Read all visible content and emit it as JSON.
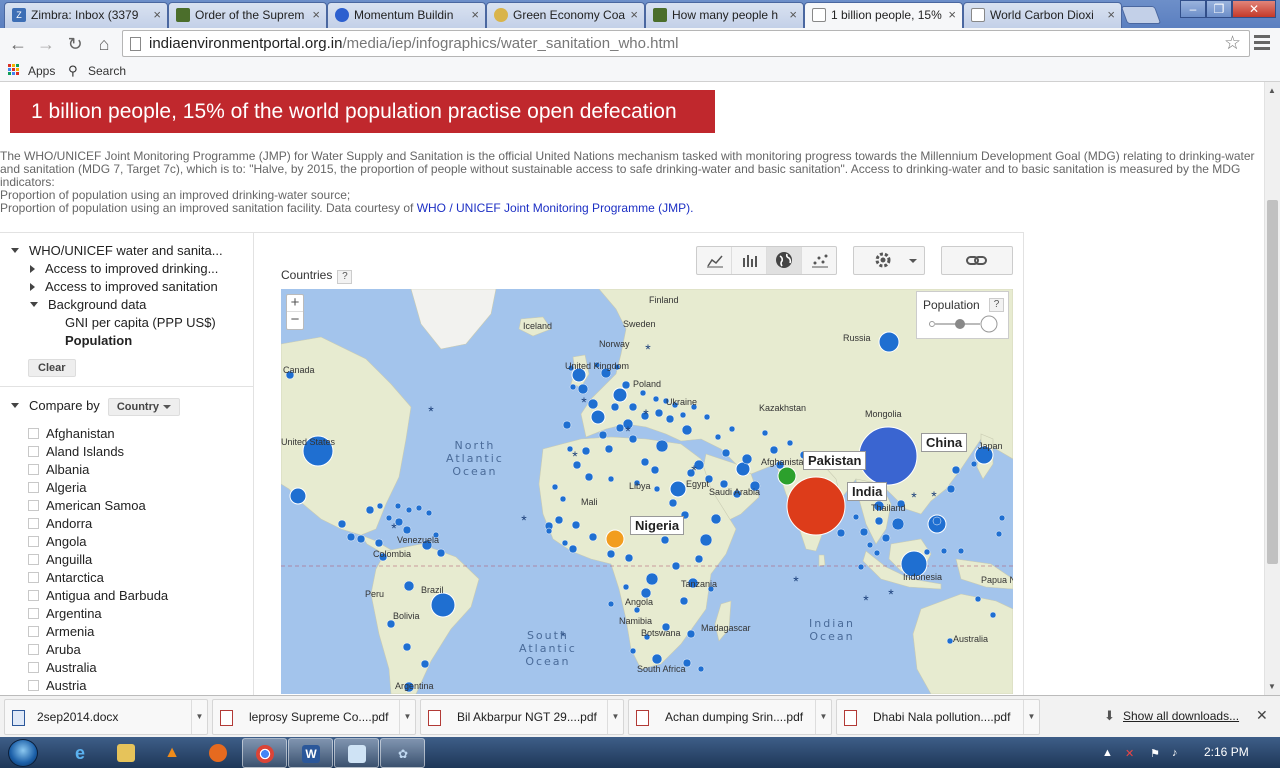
{
  "browser": {
    "tabs": [
      {
        "label": "Zimbra: Inbox (3379",
        "fav_text": "Z",
        "fav_color": "#3d6eb5",
        "active": false
      },
      {
        "label": "Order of the Suprem",
        "fav_text": "",
        "fav_color": "#4b6e2b",
        "active": false
      },
      {
        "label": "Momentum Buildin",
        "fav_text": "",
        "fav_color": "#2c5fcf",
        "active": false
      },
      {
        "label": "Green Economy Coa",
        "fav_text": "",
        "fav_color": "#d9b44a",
        "active": false
      },
      {
        "label": "How many people h",
        "fav_text": "",
        "fav_color": "#4b6e2b",
        "active": false
      },
      {
        "label": "1 billion people, 15%",
        "fav_text": "",
        "fav_color": "#ffffff",
        "active": true
      },
      {
        "label": "World Carbon Dioxi",
        "fav_text": "",
        "fav_color": "#ffffff",
        "active": false
      }
    ],
    "url_host": "indiaenvironmentportal.org.in",
    "url_path": "/media/iep/infographics/water_sanitation_who.html",
    "bookmarks": {
      "apps": "Apps",
      "search": "Search"
    }
  },
  "page": {
    "banner": "1 billion people, 15% of the world population practise open defecation",
    "intro_p1": "The WHO/UNICEF Joint Monitoring Programme (JMP) for Water Supply and Sanitation is the official United Nations mechanism tasked with monitoring progress towards the Millennium Development Goal (MDG) relating to drinking-water and sanitation (MDG 7, Target 7c), which is to: \"Halve, by 2015, the proportion of people without sustainable access to safe drinking-water and basic sanitation\". Access to drinking-water and to basic sanitation is measured by the MDG indicators:",
    "intro_p2": "Proportion of population using an improved drinking-water source;",
    "intro_p3": "Proportion of population using an improved sanitation facility. Data courtesy of",
    "intro_link": "WHO / UNICEF Joint Monitoring Programme (JMP).",
    "tree": {
      "root": "WHO/UNICEF water and sanita...",
      "item1": "Access to improved drinking...",
      "item2": "Access to improved sanitation",
      "item3": "Background data",
      "sub1": "GNI per capita (PPP US$)",
      "sub2": "Population"
    },
    "clear_label": "Clear",
    "compare_by": "Compare by",
    "compare_value": "Country",
    "countries": [
      "Afghanistan",
      "Aland Islands",
      "Albania",
      "Algeria",
      "American Samoa",
      "Andorra",
      "Angola",
      "Anguilla",
      "Antarctica",
      "Antigua and Barbuda",
      "Argentina",
      "Armenia",
      "Aruba",
      "Australia",
      "Austria"
    ],
    "viz": {
      "countries_label": "Countries",
      "help": "?",
      "legend_title": "Population",
      "labels": {
        "china": "China",
        "india": "India",
        "pakistan": "Pakistan",
        "nigeria": "Nigeria"
      },
      "colors": {
        "china": "#3a65d1",
        "india": "#dd3c1a",
        "pakistan": "#2ca02c",
        "nigeria": "#f29d1f",
        "dots": "#1f6fd1",
        "land": "#e9ecd2",
        "water": "#a3c4ec"
      },
      "oceans": {
        "north_atlantic": "North\nAtlantic\nOcean",
        "south_atlantic": "South\nAtlantic\nOcean",
        "indian": "Indian\nOcean"
      },
      "places": [
        "Finland",
        "Sweden",
        "Norway",
        "Iceland",
        "Russia",
        "United Kingdom",
        "Poland",
        "Ukraine",
        "Kazakhstan",
        "Mongolia",
        "Japan",
        "Afghanistan",
        "Thailand",
        "Indonesia",
        "Papua New Guinea",
        "Australia",
        "Madagascar",
        "Namibia",
        "Botswana",
        "South Africa",
        "Tanzania",
        "Angola",
        "Libya",
        "Egypt",
        "Saudi Arabia",
        "Mali",
        "Venezuela",
        "Colombia",
        "Bolivia",
        "Brazil",
        "Peru",
        "Argentina",
        "Canada",
        "United States"
      ]
    }
  },
  "downloads": {
    "items": [
      {
        "name": "2sep2014.docx",
        "kind": "doc"
      },
      {
        "name": "leprosy Supreme Co....pdf",
        "kind": "pdf"
      },
      {
        "name": "Bil Akbarpur NGT 29....pdf",
        "kind": "pdf"
      },
      {
        "name": "Achan dumping Srin....pdf",
        "kind": "pdf"
      },
      {
        "name": "Dhabi Nala pollution....pdf",
        "kind": "pdf"
      }
    ],
    "show_all": "Show all downloads..."
  },
  "taskbar": {
    "time": "2:16 PM"
  }
}
